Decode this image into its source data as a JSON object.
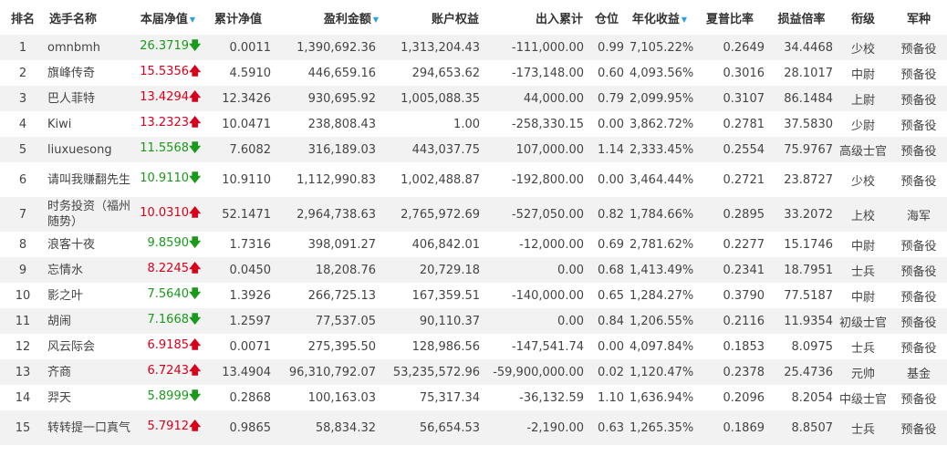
{
  "headers": {
    "rank": "排名",
    "name": "选手名称",
    "nav": "本届净值",
    "cum_nav": "累计净值",
    "profit": "盈利金额",
    "equity": "账户权益",
    "inout": "出入累计",
    "position": "仓位",
    "annual": "年化收益",
    "sharpe": "夏普比率",
    "pl_ratio": "损益倍率",
    "rank_title": "衔级",
    "army": "军种"
  },
  "sort_icon": "▼",
  "arrow_up": "🡅",
  "arrow_down": "🡇",
  "colors": {
    "up": "#d9001b",
    "down": "#1a9a1a",
    "sort": "#2aa0d8",
    "stripe": "#f2f2f2"
  },
  "rows": [
    {
      "rank": "1",
      "name": "omnbmh",
      "nav": "26.3719",
      "dir": "down",
      "cum_nav": "0.0011",
      "profit": "1,390,692.36",
      "equity": "1,313,204.43",
      "inout": "-111,000.00",
      "position": "0.99",
      "annual": "7,105.22%",
      "sharpe": "0.2649",
      "pl_ratio": "34.4468",
      "rank_title": "少校",
      "army": "预备役"
    },
    {
      "rank": "2",
      "name": "旗峰传奇",
      "nav": "15.5356",
      "dir": "up",
      "cum_nav": "4.5910",
      "profit": "446,659.16",
      "equity": "294,653.62",
      "inout": "-173,148.00",
      "position": "0.60",
      "annual": "4,093.56%",
      "sharpe": "0.3016",
      "pl_ratio": "28.1017",
      "rank_title": "中尉",
      "army": "预备役"
    },
    {
      "rank": "3",
      "name": "巴人菲特",
      "nav": "13.4294",
      "dir": "up",
      "cum_nav": "12.3426",
      "profit": "930,695.92",
      "equity": "1,005,088.35",
      "inout": "44,000.00",
      "position": "0.79",
      "annual": "2,099.95%",
      "sharpe": "0.3107",
      "pl_ratio": "86.1484",
      "rank_title": "上尉",
      "army": "预备役"
    },
    {
      "rank": "4",
      "name": "Kiwi",
      "nav": "13.2323",
      "dir": "up",
      "cum_nav": "10.0471",
      "profit": "238,808.43",
      "equity": "1.00",
      "inout": "-258,330.15",
      "position": "0.00",
      "annual": "3,862.72%",
      "sharpe": "0.2781",
      "pl_ratio": "37.5830",
      "rank_title": "少尉",
      "army": "预备役"
    },
    {
      "rank": "5",
      "name": "liuxuesong",
      "nav": "11.5568",
      "dir": "down",
      "cum_nav": "7.6082",
      "profit": "316,189.03",
      "equity": "443,037.75",
      "inout": "107,000.00",
      "position": "1.14",
      "annual": "2,333.45%",
      "sharpe": "0.2554",
      "pl_ratio": "75.9767",
      "rank_title": "高级士官",
      "army": "预备役"
    },
    {
      "rank": "6",
      "name": "请叫我赚翻先生",
      "nav": "10.9110",
      "dir": "down",
      "cum_nav": "10.9110",
      "profit": "1,112,990.83",
      "equity": "1,002,488.87",
      "inout": "-192,800.00",
      "position": "0.00",
      "annual": "3,464.44%",
      "sharpe": "0.2721",
      "pl_ratio": "23.8727",
      "rank_title": "少校",
      "army": "预备役"
    },
    {
      "rank": "7",
      "name": "时务投资（福州随势）",
      "nav": "10.0310",
      "dir": "up",
      "cum_nav": "52.1471",
      "profit": "2,964,738.63",
      "equity": "2,765,972.69",
      "inout": "-527,050.00",
      "position": "0.82",
      "annual": "1,784.66%",
      "sharpe": "0.2895",
      "pl_ratio": "33.2072",
      "rank_title": "上校",
      "army": "海军"
    },
    {
      "rank": "8",
      "name": "浪客十夜",
      "nav": "9.8590",
      "dir": "down",
      "cum_nav": "1.7316",
      "profit": "398,091.27",
      "equity": "406,842.01",
      "inout": "-12,000.00",
      "position": "0.69",
      "annual": "2,781.62%",
      "sharpe": "0.2277",
      "pl_ratio": "15.1746",
      "rank_title": "中尉",
      "army": "预备役"
    },
    {
      "rank": "9",
      "name": "忘情水",
      "nav": "8.2245",
      "dir": "up",
      "cum_nav": "0.0450",
      "profit": "18,208.76",
      "equity": "20,729.18",
      "inout": "0.00",
      "position": "0.68",
      "annual": "1,413.49%",
      "sharpe": "0.2341",
      "pl_ratio": "18.7951",
      "rank_title": "士兵",
      "army": "预备役"
    },
    {
      "rank": "10",
      "name": "影之叶",
      "nav": "7.5640",
      "dir": "down",
      "cum_nav": "1.3926",
      "profit": "266,725.13",
      "equity": "167,359.51",
      "inout": "-140,000.00",
      "position": "0.65",
      "annual": "1,284.27%",
      "sharpe": "0.3790",
      "pl_ratio": "77.5187",
      "rank_title": "中尉",
      "army": "预备役"
    },
    {
      "rank": "11",
      "name": "胡闹",
      "nav": "7.1668",
      "dir": "down",
      "cum_nav": "1.2597",
      "profit": "77,537.05",
      "equity": "90,110.37",
      "inout": "0.00",
      "position": "0.84",
      "annual": "1,206.55%",
      "sharpe": "0.2116",
      "pl_ratio": "11.9354",
      "rank_title": "初级士官",
      "army": "预备役"
    },
    {
      "rank": "12",
      "name": "风云际会",
      "nav": "6.9185",
      "dir": "up",
      "cum_nav": "0.0071",
      "profit": "275,395.50",
      "equity": "128,986.56",
      "inout": "-147,541.74",
      "position": "0.00",
      "annual": "4,097.84%",
      "sharpe": "0.1853",
      "pl_ratio": "8.0975",
      "rank_title": "士兵",
      "army": "预备役"
    },
    {
      "rank": "13",
      "name": "齐商",
      "nav": "6.7243",
      "dir": "up",
      "cum_nav": "13.4904",
      "profit": "96,310,792.07",
      "equity": "53,235,572.96",
      "inout": "-59,900,000.00",
      "position": "0.02",
      "annual": "1,120.47%",
      "sharpe": "0.2378",
      "pl_ratio": "25.4736",
      "rank_title": "元帅",
      "army": "基金"
    },
    {
      "rank": "14",
      "name": "羿天",
      "nav": "5.8999",
      "dir": "down",
      "cum_nav": "0.2868",
      "profit": "100,163.03",
      "equity": "75,317.34",
      "inout": "-36,132.59",
      "position": "1.10",
      "annual": "1,636.94%",
      "sharpe": "0.2096",
      "pl_ratio": "8.2054",
      "rank_title": "中级士官",
      "army": "预备役"
    },
    {
      "rank": "15",
      "name": "转转提一口真气",
      "nav": "5.7912",
      "dir": "up",
      "cum_nav": "0.9865",
      "profit": "58,834.32",
      "equity": "56,654.53",
      "inout": "-2,190.00",
      "position": "0.63",
      "annual": "1,265.35%",
      "sharpe": "0.1869",
      "pl_ratio": "8.8507",
      "rank_title": "士兵",
      "army": "预备役"
    }
  ]
}
